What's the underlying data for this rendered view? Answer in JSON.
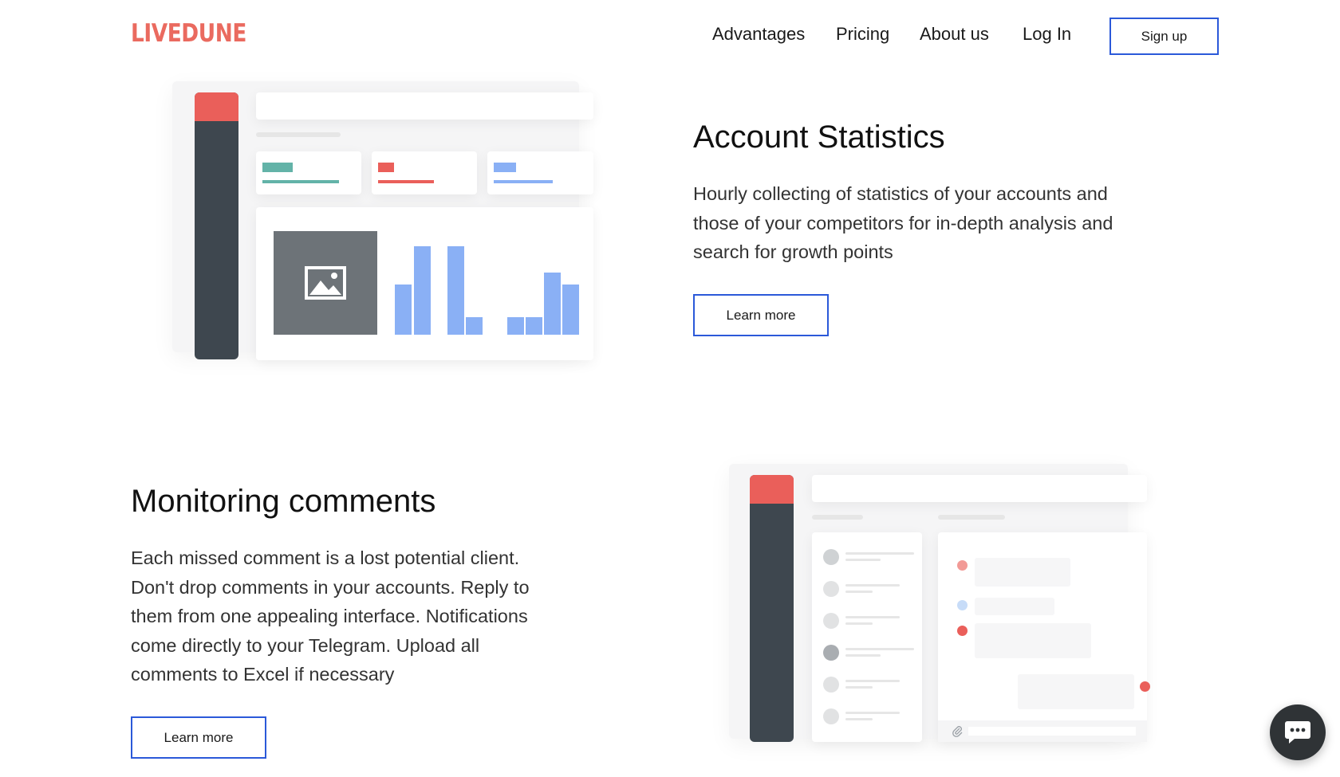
{
  "header": {
    "logo": "LIVEDUNE",
    "nav": [
      "Advantages",
      "Pricing",
      "About us",
      "Log In"
    ],
    "signup_label": "Sign up"
  },
  "sections": [
    {
      "title": "Account Statistics",
      "description": "Hourly collecting of statistics of your accounts and those of your competitors for in-depth analysis and search for growth points",
      "button_label": "Learn more"
    },
    {
      "title": "Monitoring comments",
      "description": "Each missed comment is a lost potential client. Don't drop comments in your accounts. Reply to them from one appealing interface. Notifications come directly to your Telegram. Upload all comments to Excel if necessary",
      "button_label": "Learn more"
    }
  ],
  "colors": {
    "brand": "#ea6a5f",
    "accent_button_border": "#2b59d9",
    "sidebar_dark": "#3e474f",
    "chart_bar": "#8ab0f5",
    "teal": "#63b3a8",
    "red": "#ea5f5a",
    "blue": "#8ab0f5"
  },
  "icons": {
    "image_placeholder": "image-icon",
    "chat": "chat-bubble-icon",
    "attachment": "paperclip-icon"
  }
}
